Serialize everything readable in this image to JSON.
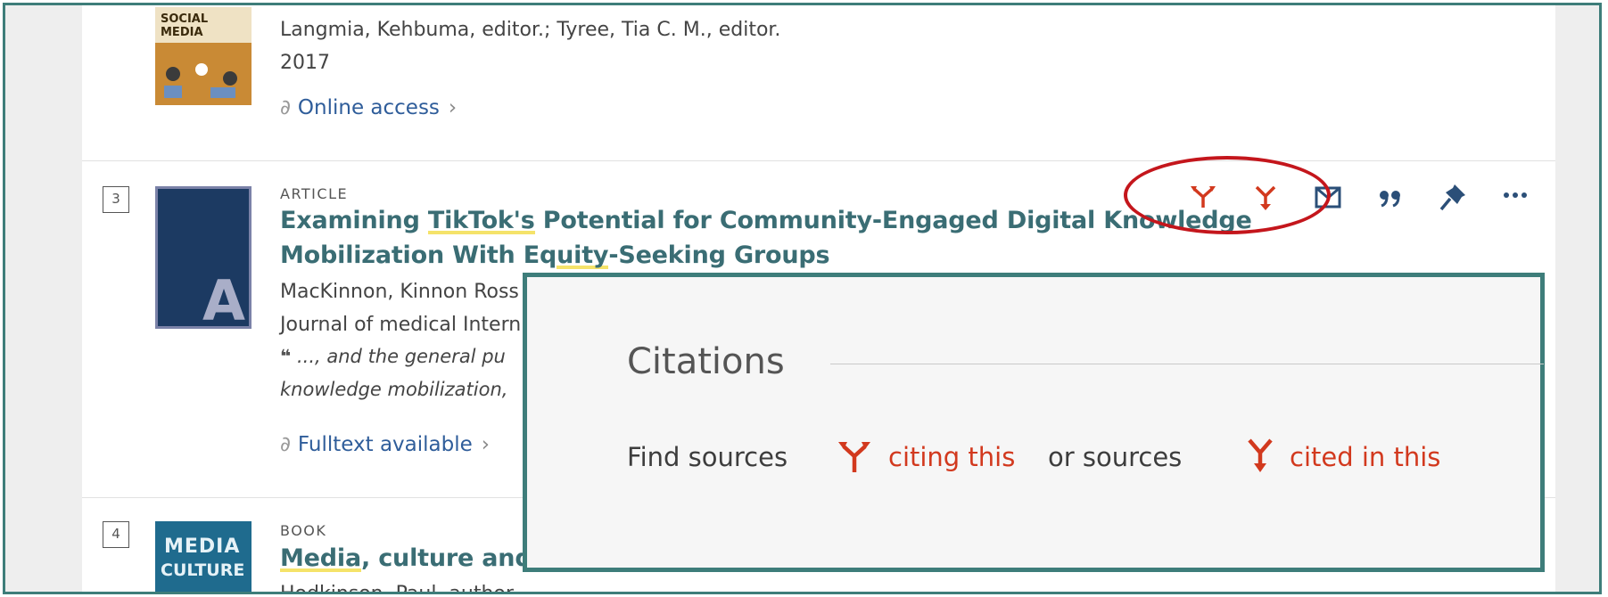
{
  "results": [
    {
      "thumb_text": "SOCIAL MEDIA",
      "authors": "Langmia, Kehbuma, editor.; Tyree, Tia C. M., editor.",
      "year": "2017",
      "link": "Online access"
    },
    {
      "number": "3",
      "type": "ARTICLE",
      "thumb_letter": "A",
      "title_line1_pre": "Examining ",
      "title_line1_hl": "TikTok's",
      "title_line1_post": " Potential for Community-Engaged Digital Knowledge",
      "title_line2_pre": "Mobilization With Eq",
      "title_line2_hl": "uity",
      "title_line2_post": "-Seeking Groups",
      "authors": "MacKinnon, Kinnon Ross",
      "journal": "Journal of medical Intern",
      "snippet_mark": "❝",
      "snippet1": " ..., and the general pu",
      "snippet2": "knowledge mobilization,",
      "link": "Fulltext available"
    },
    {
      "number": "4",
      "type": "BOOK",
      "thumb_text": [
        "MEDIA",
        "CULTURE"
      ],
      "title_hl": "Media",
      "title_post": ", culture and s",
      "authors": "Hodkinson, Paul, author."
    }
  ],
  "popup": {
    "title": "Citations",
    "find_sources": "Find sources",
    "citing_this": "citing this",
    "or_sources": "or sources",
    "cited_in_this": "cited in this"
  },
  "colors": {
    "accent_red": "#d2391e",
    "title_teal": "#3a6d74",
    "link_blue": "#2f5d9a",
    "frame": "#3e7d7a",
    "highlight": "#f5e36a"
  }
}
